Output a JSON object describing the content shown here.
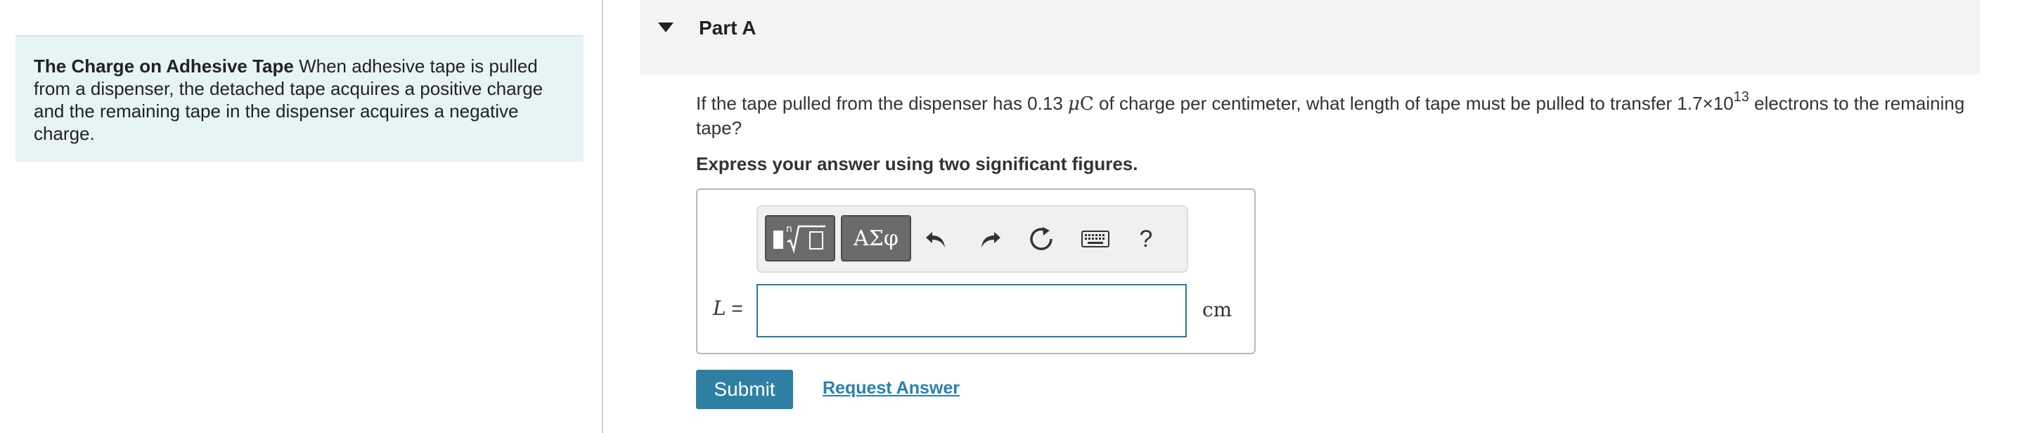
{
  "intro": {
    "title": "The Charge on Adhesive Tape",
    "text": "When adhesive tape is pulled from a dispenser, the detached tape acquires a positive charge and the remaining tape in the dispenser acquires a negative charge."
  },
  "part": {
    "title": "Part A"
  },
  "question": {
    "text_before": "If the tape pulled from the dispenser has 0.13 ",
    "mu": "μ",
    "charge_unit": "C",
    "text_middle": " of charge per centimeter, what length of tape must be pulled to transfer 1.7×10",
    "exponent": "13",
    "text_after": " electrons to the remaining tape?"
  },
  "instruction": "Express your answer using two significant figures.",
  "toolbar": {
    "greek_label": "ΑΣφ",
    "help_label": "?"
  },
  "answer": {
    "variable": "L",
    "equals": " =",
    "value": "",
    "unit": "cm"
  },
  "actions": {
    "submit_label": "Submit",
    "request_answer_label": "Request Answer"
  },
  "icons": {
    "toggle": "caret-down-icon",
    "templates": "templates-icon",
    "undo": "undo-icon",
    "redo": "redo-icon",
    "reset": "reset-icon",
    "keyboard": "keyboard-icon"
  },
  "colors": {
    "accent": "#2e7fa3",
    "intro_background": "#e7f4f6",
    "input_border": "#2a7a9c",
    "link": "#2a7fb0"
  }
}
